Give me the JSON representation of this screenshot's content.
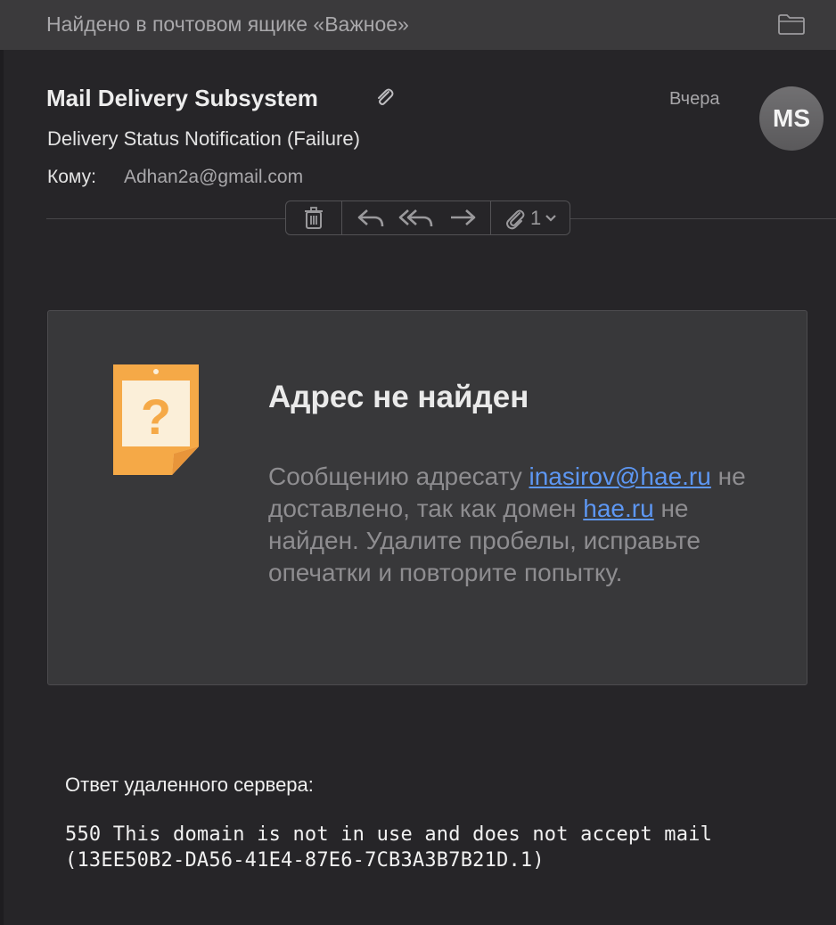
{
  "header": {
    "found_in": "Найдено в почтовом ящике «Важное»",
    "folder_icon": "folder-icon"
  },
  "message": {
    "sender": "Mail Delivery Subsystem",
    "has_attachment_icon": "paperclip-icon",
    "date": "Вчера",
    "avatar_initials": "MS",
    "subject": "Delivery Status Notification (Failure)",
    "to_label": "Кому:",
    "to_value": "Adhan2a@gmail.com"
  },
  "toolbar": {
    "icons": [
      "trash-icon",
      "reply-icon",
      "reply-all-icon",
      "forward-icon",
      "paperclip-icon",
      "chevron-down-icon"
    ],
    "attachment_count": "1"
  },
  "card": {
    "title": "Адрес не найден",
    "body_part1": "Сообщению адресату ",
    "recipient_link": "inasirov@hae.ru",
    "body_part2": " не доставлено, так как домен ",
    "domain_link": "hae.ru",
    "body_part3": " не найден. Удалите пробелы, исправьте опечатки и повторите попытку.",
    "link_color": "#5d97f3",
    "note_color": "#f5a947"
  },
  "server_reply": {
    "label": "Ответ удаленного сервера:",
    "text": "550 This domain is not in use and does not accept mail (13EE50B2-DA56-41E4-87E6-7CB3A3B7B21D.1)"
  }
}
